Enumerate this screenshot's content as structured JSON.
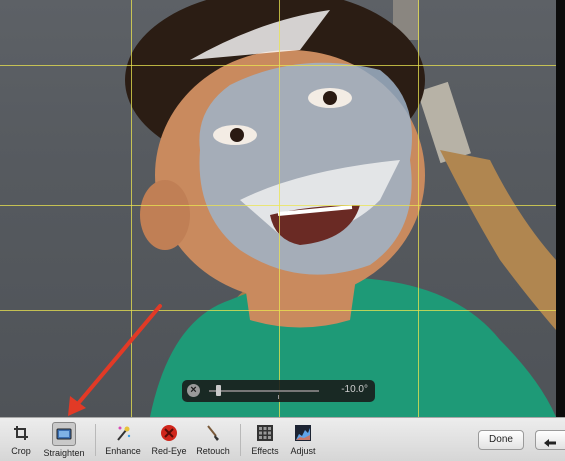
{
  "straighten_hud": {
    "angle_label": "-10.0°",
    "slider_value": -10.0,
    "close_icon": "x-circle-icon"
  },
  "toolbar": {
    "tools": [
      {
        "label": "Crop",
        "icon": "crop-icon"
      },
      {
        "label": "Straighten",
        "icon": "straighten-icon"
      },
      {
        "label": "Enhance",
        "icon": "magic-wand-icon"
      },
      {
        "label": "Red-Eye",
        "icon": "red-eye-icon"
      },
      {
        "label": "Retouch",
        "icon": "brush-icon"
      },
      {
        "label": "Effects",
        "icon": "effects-grid-icon"
      },
      {
        "label": "Adjust",
        "icon": "histogram-icon"
      }
    ],
    "done_label": "Done",
    "prev_icon": "arrow-left-icon"
  },
  "colors": {
    "grid": "#ebe450",
    "annotation_arrow": "#e23a26",
    "toolbar_bg": "#e0e0e0"
  }
}
